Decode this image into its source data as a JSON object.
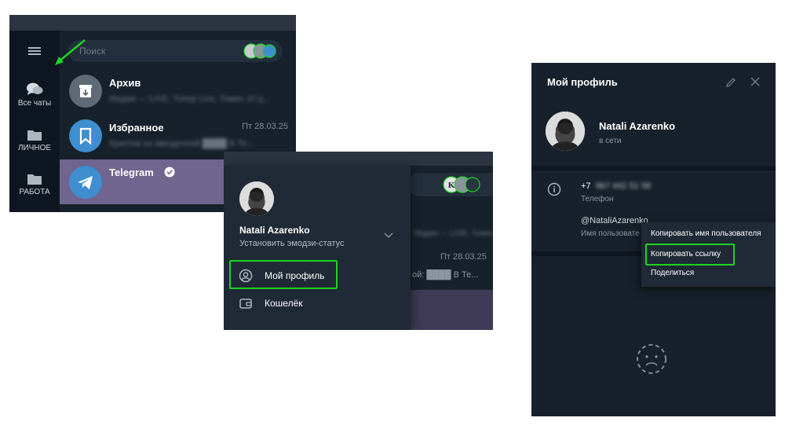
{
  "panel1": {
    "menu_icon": "hamburger-icon",
    "search": {
      "placeholder": "Поиск"
    },
    "folders": [
      {
        "label": "Все чаты",
        "icon": "chats-icon"
      },
      {
        "label": "ЛИЧНОЕ",
        "icon": "folder-icon"
      },
      {
        "label": "РАБОТА",
        "icon": "folder-icon"
      }
    ],
    "chats": [
      {
        "name": "Архив",
        "preview": "Мидии — LIVE, Топор Live, Тимес of Ц...",
        "date": "",
        "icon": "archive-icon",
        "color": "#5e6a75"
      },
      {
        "name": "Избранное",
        "preview": "Криптик из звездочной ████ В Те...",
        "date": "Пт 28.03.25",
        "icon": "bookmark-icon",
        "color": "#3e8ed0"
      },
      {
        "name": "Telegram",
        "preview": "",
        "date": "",
        "icon": "telegram-icon",
        "color": "#3e8ed0",
        "verified": true
      }
    ],
    "arrow_color": "#1ed322"
  },
  "panel2": {
    "profile": {
      "name": "Natali Azarenko",
      "status": "Установить эмодзи-статус"
    },
    "menu": [
      {
        "label": "Мой профиль",
        "icon": "user-circle-icon",
        "highlighted": true
      },
      {
        "label": "Кошелёк",
        "icon": "wallet-icon",
        "highlighted": false
      }
    ],
    "bg": {
      "preview1": "Мидии — LIVE, Тимес of Ц...",
      "date": "Пт 28.03.25",
      "preview2": "ой: ████ В Те..."
    }
  },
  "panel3": {
    "title": "Мой профиль",
    "name": "Natali Azarenko",
    "online": "в сети",
    "phone": "+7",
    "phone_hidden": "967 442 51 58",
    "phone_label": "Телефон",
    "username": "@NataliAzarenko",
    "username_label": "Имя пользовате",
    "context_menu": [
      {
        "label": "Копировать имя пользователя",
        "highlighted": false
      },
      {
        "label": "Копировать ссылку",
        "highlighted": true
      },
      {
        "label": "Поделиться",
        "highlighted": false
      }
    ]
  },
  "colors": {
    "bg_dark": "#17212b",
    "highlight": "#1ed322",
    "accent": "#3e8ed0",
    "selected_row": "#6f658f"
  }
}
